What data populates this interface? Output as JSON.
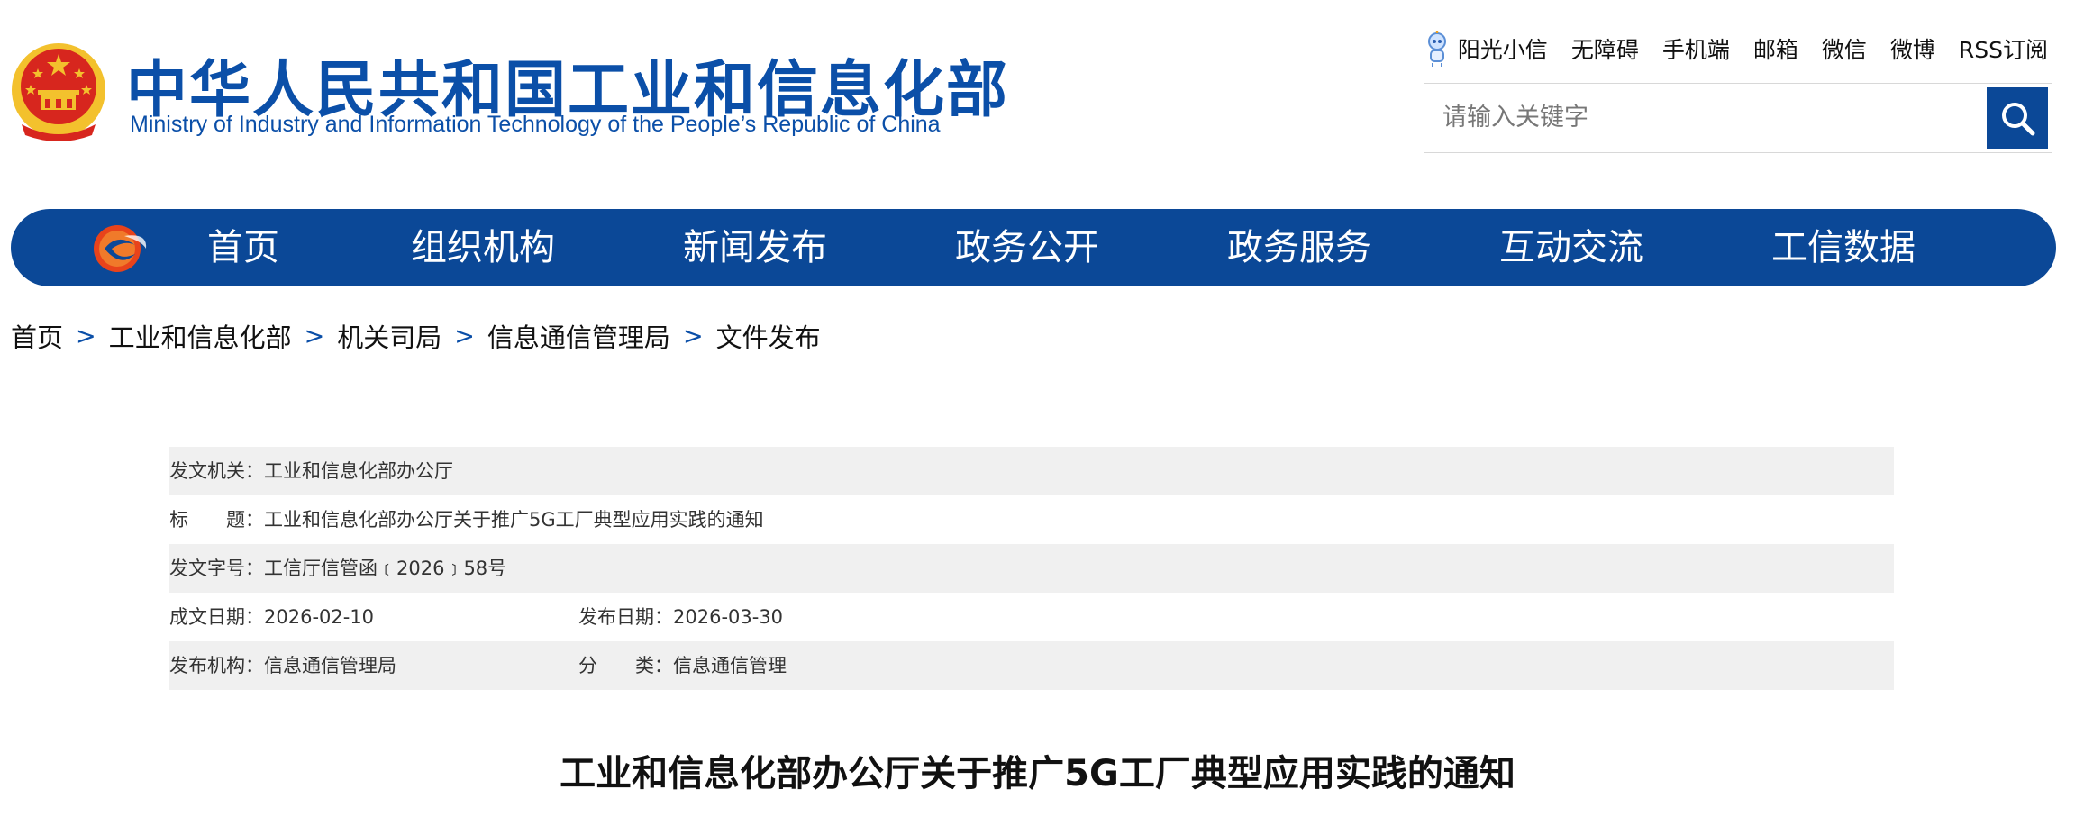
{
  "header": {
    "site_title": "中华人民共和国工业和信息化部",
    "site_subtitle": "Ministry of Industry and Information Technology of the People’s Republic of China",
    "top_links": {
      "sunshine": "阳光小信",
      "accessibility": "无障碍",
      "mobile": "手机端",
      "mailbox": "邮箱",
      "wechat": "微信",
      "weibo": "微博",
      "rss": "RSS订阅"
    },
    "search": {
      "placeholder": "请输入关键字",
      "value": "",
      "button_icon": "search-icon"
    }
  },
  "nav": {
    "items": [
      {
        "label": "首页"
      },
      {
        "label": "组织机构"
      },
      {
        "label": "新闻发布"
      },
      {
        "label": "政务公开"
      },
      {
        "label": "政务服务"
      },
      {
        "label": "互动交流"
      },
      {
        "label": "工信数据"
      }
    ]
  },
  "breadcrumb": {
    "items": [
      "首页",
      "工业和信息化部",
      "机关司局",
      "信息通信管理局",
      "文件发布"
    ],
    "separator": ">"
  },
  "meta": {
    "issuer": "发文机关：工业和信息化部办公厅",
    "title": "标　　题：工业和信息化部办公厅关于推广5G工厂典型应用实践的通知",
    "doc_number": "发文字号：工信厅信管函﹝2026﹞58号",
    "created_date": "成文日期：2026-02-10",
    "publish_date": "发布日期：2026-03-30",
    "publisher": "发布机构：信息通信管理局",
    "category": "分　　类：信息通信管理"
  },
  "document": {
    "title": "工业和信息化部办公厅关于推广5G工厂典型应用实践的通知"
  },
  "colors": {
    "brand_blue": "#0b4897",
    "title_blue": "#0b4fa8",
    "emblem_red": "#d7261e",
    "emblem_gold": "#f3c12d",
    "meta_shade": "#f0f0f0"
  }
}
